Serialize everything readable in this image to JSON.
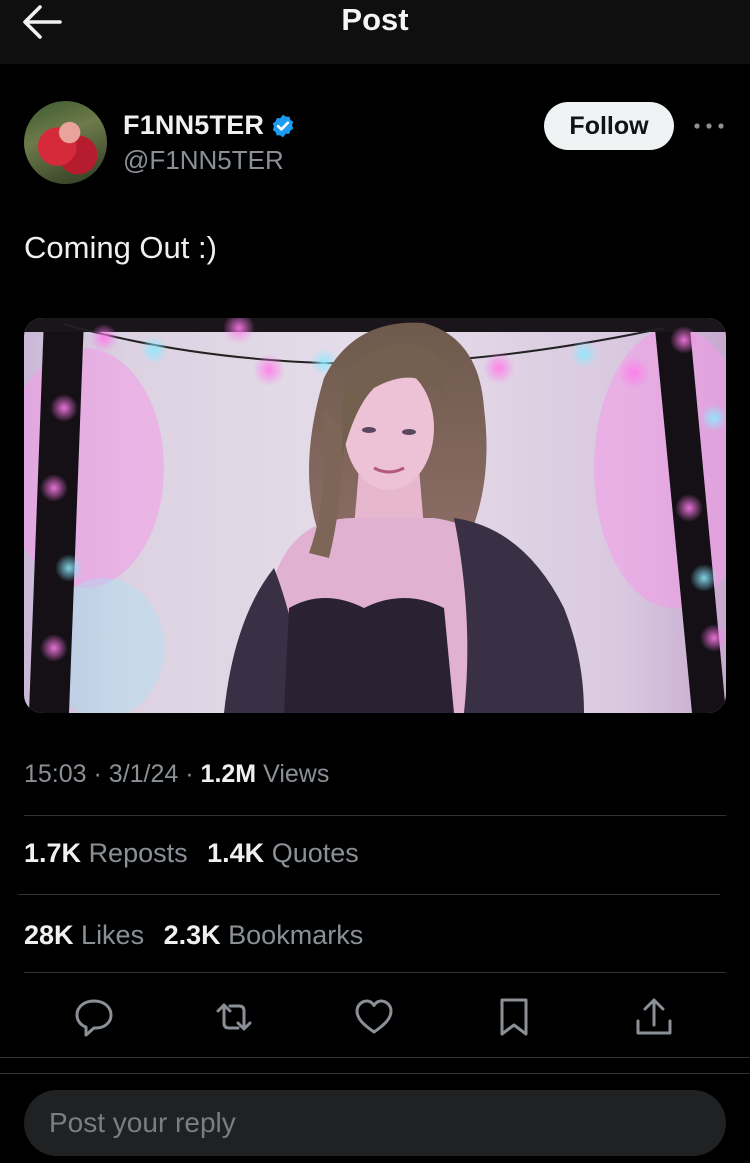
{
  "header": {
    "title": "Post",
    "back_icon": "arrow-left-icon"
  },
  "author": {
    "display_name": "F1NN5TER",
    "handle": "@F1NN5TER",
    "verified": true,
    "verified_color": "#1d9bf0",
    "follow_label": "Follow",
    "more_icon": "ellipsis-icon"
  },
  "post": {
    "text": "Coming Out :)",
    "time": "15:03",
    "sep1": "·",
    "date": "3/1/24",
    "sep2": "·",
    "views_count": "1.2M",
    "views_label": "Views"
  },
  "stats": {
    "reposts_count": "1.7K",
    "reposts_label": "Reposts",
    "quotes_count": "1.4K",
    "quotes_label": "Quotes",
    "likes_count": "28K",
    "likes_label": "Likes",
    "bookmarks_count": "2.3K",
    "bookmarks_label": "Bookmarks"
  },
  "actions": [
    "reply-icon",
    "repost-icon",
    "like-icon",
    "bookmark-icon",
    "share-icon"
  ],
  "reply": {
    "placeholder": "Post your reply"
  },
  "colors": {
    "background": "#000000",
    "accent": "#1d9bf0",
    "muted_text": "#8b9096",
    "divider": "#2f3336"
  }
}
